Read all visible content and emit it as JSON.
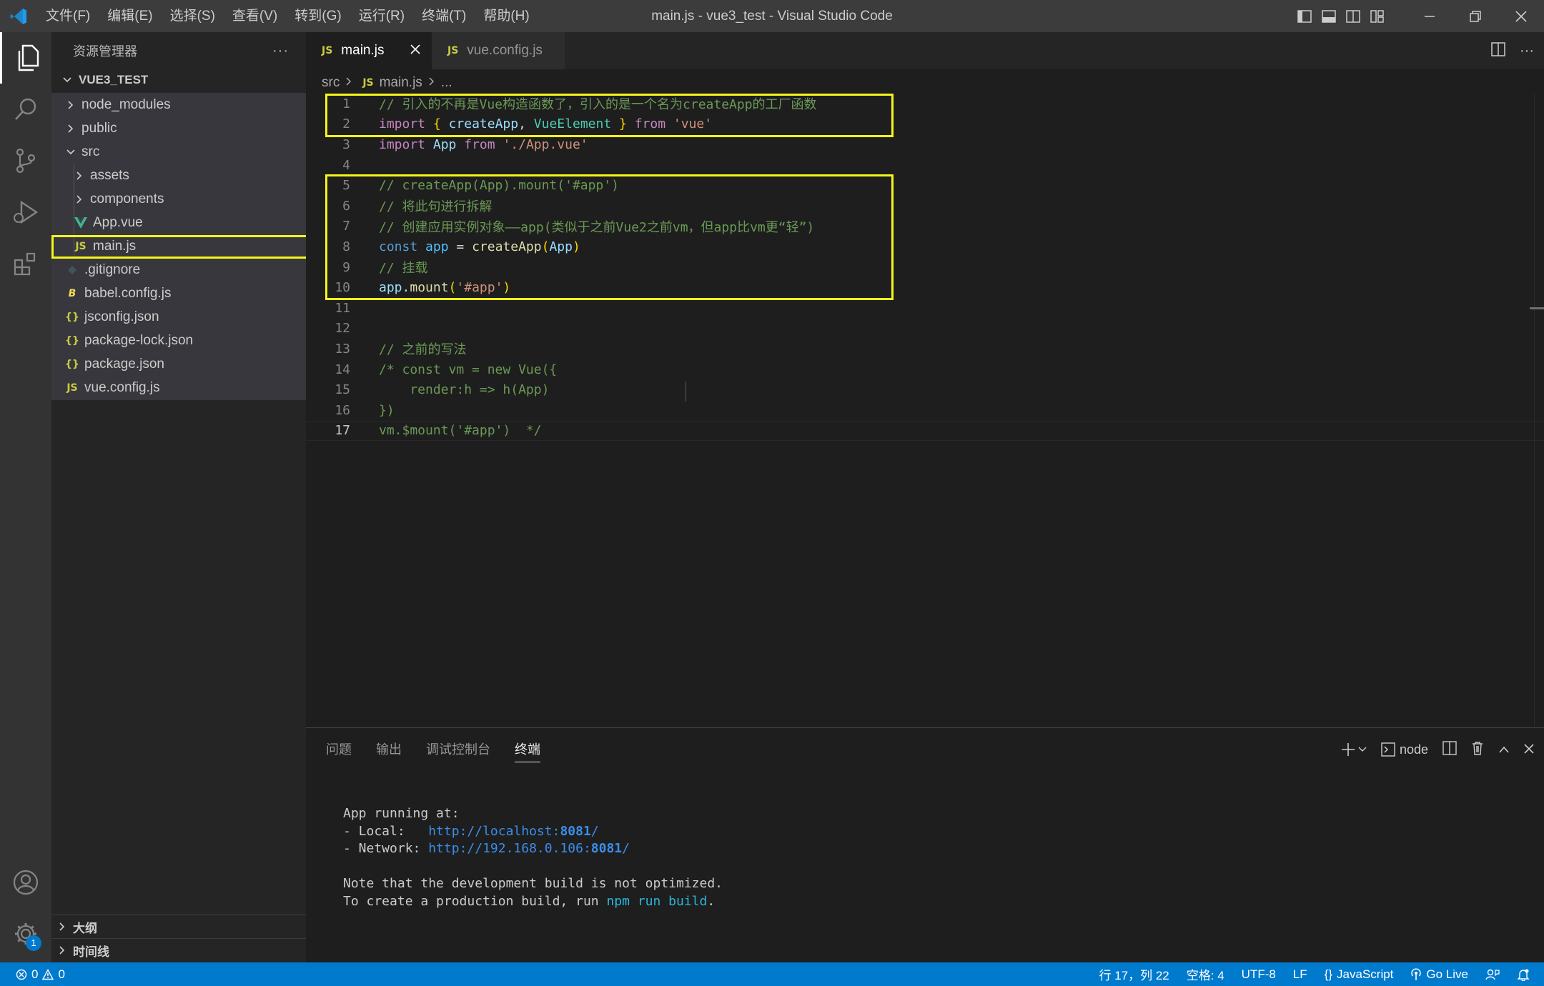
{
  "window": {
    "title": "main.js - vue3_test - Visual Studio Code",
    "menu": [
      "文件(F)",
      "编辑(E)",
      "选择(S)",
      "查看(V)",
      "转到(G)",
      "运行(R)",
      "终端(T)",
      "帮助(H)"
    ]
  },
  "sidebar": {
    "title": "资源管理器",
    "more": "···",
    "folder": "VUE3_TEST",
    "items": [
      {
        "label": "node_modules",
        "type": "folder",
        "expanded": false,
        "depth": 1
      },
      {
        "label": "public",
        "type": "folder",
        "expanded": false,
        "depth": 1
      },
      {
        "label": "src",
        "type": "folder",
        "expanded": true,
        "depth": 1
      },
      {
        "label": "assets",
        "type": "folder",
        "expanded": false,
        "depth": 2
      },
      {
        "label": "components",
        "type": "folder",
        "expanded": false,
        "depth": 2
      },
      {
        "label": "App.vue",
        "type": "vue",
        "depth": 2
      },
      {
        "label": "main.js",
        "type": "js",
        "depth": 2,
        "selected": true
      },
      {
        "label": ".gitignore",
        "type": "git",
        "depth": 1
      },
      {
        "label": "babel.config.js",
        "type": "babel",
        "depth": 1
      },
      {
        "label": "jsconfig.json",
        "type": "json",
        "depth": 1
      },
      {
        "label": "package-lock.json",
        "type": "json",
        "depth": 1
      },
      {
        "label": "package.json",
        "type": "json",
        "depth": 1
      },
      {
        "label": "vue.config.js",
        "type": "js",
        "depth": 1
      }
    ],
    "icons": {
      "js": "JS",
      "json": "{}",
      "babel": "B"
    },
    "sections": [
      "大纲",
      "时间线"
    ]
  },
  "activitybar": {
    "settings_badge": "1"
  },
  "editor": {
    "tabs": [
      {
        "label": "main.js",
        "active": true
      },
      {
        "label": "vue.config.js",
        "active": false
      }
    ],
    "breadcrumb": {
      "folder": "src",
      "file": "main.js",
      "more": "..."
    },
    "current_line": 17,
    "lines": [
      [
        [
          "c-cm",
          "// 引入的不再是Vue构造函数了，引入的是一个名为createApp的工厂函数"
        ]
      ],
      [
        [
          "c-kw",
          "import"
        ],
        [
          "c-op",
          " "
        ],
        [
          "c-br",
          "{"
        ],
        [
          "c-op",
          " "
        ],
        [
          "c-vr",
          "createApp"
        ],
        [
          "c-op",
          ", "
        ],
        [
          "c-cls",
          "VueElement"
        ],
        [
          "c-op",
          " "
        ],
        [
          "c-br",
          "}"
        ],
        [
          "c-op",
          " "
        ],
        [
          "c-kw",
          "from"
        ],
        [
          "c-op",
          " "
        ],
        [
          "c-str",
          "'vue'"
        ]
      ],
      [
        [
          "c-kw",
          "import"
        ],
        [
          "c-op",
          " "
        ],
        [
          "c-vr",
          "App"
        ],
        [
          "c-op",
          " "
        ],
        [
          "c-kw",
          "from"
        ],
        [
          "c-op",
          " "
        ],
        [
          "c-str",
          "'./App.vue'"
        ]
      ],
      [],
      [
        [
          "c-cm",
          "// createApp(App).mount('#app')"
        ]
      ],
      [
        [
          "c-cm",
          "// 将此句进行拆解"
        ]
      ],
      [
        [
          "c-cm",
          "// 创建应用实例对象——app(类似于之前Vue2之前vm，但app比vm更“轻”)"
        ]
      ],
      [
        [
          "c-sk",
          "const"
        ],
        [
          "c-op",
          " "
        ],
        [
          "c-cv",
          "app"
        ],
        [
          "c-op",
          " = "
        ],
        [
          "c-fn",
          "createApp"
        ],
        [
          "c-br",
          "("
        ],
        [
          "c-vr",
          "App"
        ],
        [
          "c-br",
          ")"
        ]
      ],
      [
        [
          "c-cm",
          "// 挂载"
        ]
      ],
      [
        [
          "c-vr",
          "app"
        ],
        [
          "c-op",
          "."
        ],
        [
          "c-fn",
          "mount"
        ],
        [
          "c-br",
          "("
        ],
        [
          "c-str",
          "'#app'"
        ],
        [
          "c-br",
          ")"
        ]
      ],
      [],
      [],
      [
        [
          "c-cm",
          "// 之前的写法"
        ]
      ],
      [
        [
          "c-cm",
          "/* const vm = new Vue({"
        ]
      ],
      [
        [
          "c-cm",
          "    render:h => h(App)"
        ]
      ],
      [
        [
          "c-cm",
          "})"
        ]
      ],
      [
        [
          "c-cm",
          "vm.$mount('#app')  */"
        ]
      ]
    ]
  },
  "panel": {
    "tabs": [
      "问题",
      "输出",
      "调试控制台",
      "终端"
    ],
    "active_tab": "终端",
    "terminal_name": "node",
    "terminal": [
      [],
      [
        [
          "",
          "App running at:"
        ]
      ],
      [
        [
          "",
          "- Local:   "
        ],
        [
          "t-link",
          "http://localhost:"
        ],
        [
          "t-bold",
          "8081"
        ],
        [
          "t-link",
          "/"
        ]
      ],
      [
        [
          "",
          "- Network: "
        ],
        [
          "t-link",
          "http://192.168.0.106:"
        ],
        [
          "t-bold",
          "8081"
        ],
        [
          "t-link",
          "/"
        ]
      ],
      [],
      [
        [
          "",
          "Note that the development build is not optimized."
        ]
      ],
      [
        [
          "",
          "To create a production build, run "
        ],
        [
          "t-cmd",
          "npm run build"
        ],
        [
          "",
          "."
        ]
      ]
    ]
  },
  "statusbar": {
    "errors": "0",
    "warnings": "0",
    "position": "行 17，列 22",
    "spaces": "空格: 4",
    "encoding": "UTF-8",
    "eol": "LF",
    "language": "JavaScript",
    "golive": "Go Live"
  },
  "colors": {
    "accent": "#007acc",
    "highlight_box": "#f5f51a"
  }
}
